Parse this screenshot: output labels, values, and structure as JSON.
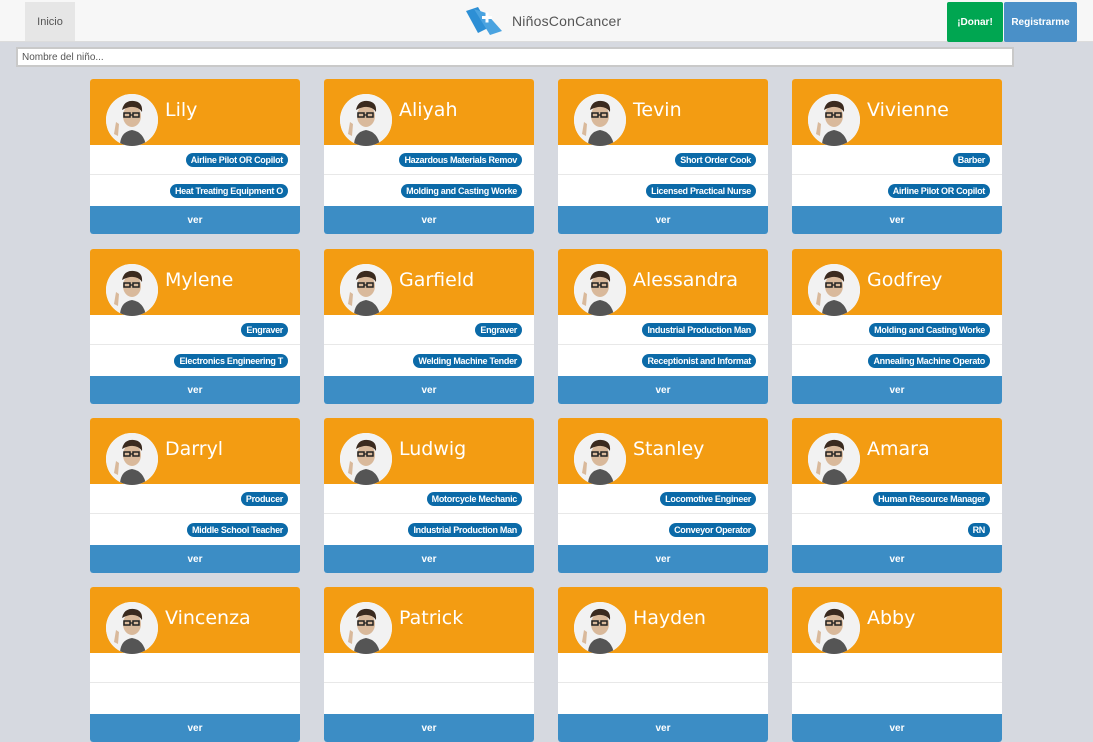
{
  "nav": {
    "home_label": "Inicio"
  },
  "brand": {
    "name": "NiñosConCancer"
  },
  "actions": {
    "donate_label": "¡Donar!",
    "register_label": "Registrarme"
  },
  "search": {
    "placeholder": "Nombre del niño..."
  },
  "button_label": "ver",
  "colors": {
    "card_header": "#f39c12",
    "tag": "#0b6aa8",
    "ver_button": "#3c8dc5",
    "donate": "#00a651",
    "register": "#4a90c8"
  },
  "cards": [
    {
      "name": "Lily",
      "tags": [
        "Airline Pilot OR Copilot",
        "Heat Treating Equipment O"
      ]
    },
    {
      "name": "Aliyah",
      "tags": [
        "Hazardous Materials Remov",
        "Molding and Casting Worke"
      ]
    },
    {
      "name": "Tevin",
      "tags": [
        "Short Order Cook",
        "Licensed Practical Nurse"
      ]
    },
    {
      "name": "Vivienne",
      "tags": [
        "Barber",
        "Airline Pilot OR Copilot"
      ]
    },
    {
      "name": "Mylene",
      "tags": [
        "Engraver",
        "Electronics Engineering T"
      ]
    },
    {
      "name": "Garfield",
      "tags": [
        "Engraver",
        "Welding Machine Tender"
      ]
    },
    {
      "name": "Alessandra",
      "tags": [
        "Industrial Production Man",
        "Receptionist and Informat"
      ]
    },
    {
      "name": "Godfrey",
      "tags": [
        "Molding and Casting Worke",
        "Annealing Machine Operato"
      ]
    },
    {
      "name": "Darryl",
      "tags": [
        "Producer",
        "Middle School Teacher"
      ]
    },
    {
      "name": "Ludwig",
      "tags": [
        "Motorcycle Mechanic",
        "Industrial Production Man"
      ]
    },
    {
      "name": "Stanley",
      "tags": [
        "Locomotive Engineer",
        "Conveyor Operator"
      ]
    },
    {
      "name": "Amara",
      "tags": [
        "Human Resource Manager",
        "RN"
      ]
    },
    {
      "name": "Vincenza",
      "tags": []
    },
    {
      "name": "Patrick",
      "tags": []
    },
    {
      "name": "Hayden",
      "tags": []
    },
    {
      "name": "Abby",
      "tags": []
    }
  ]
}
